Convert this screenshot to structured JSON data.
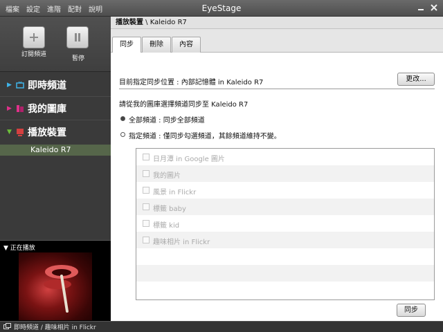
{
  "app": {
    "title": "EyeStage",
    "menu": [
      "檔案",
      "設定",
      "進階",
      "配對",
      "說明"
    ]
  },
  "sidebar": {
    "subscribe_label": "訂閱頻道",
    "pause_label": "暫停",
    "items": [
      {
        "label": "即時頻道",
        "color": "#3fb3e8"
      },
      {
        "label": "我的圖庫",
        "color": "#e0308a"
      },
      {
        "label": "播放裝置",
        "color": "#d44040"
      }
    ],
    "device": "Kaleido R7",
    "now_playing_label": "正在播放"
  },
  "status_bar": {
    "text": "即時頻道 / 趣味相片 in Flickr"
  },
  "main": {
    "breadcrumb_bold": "播放裝置",
    "breadcrumb_rest": " \\ Kaleido R7",
    "tabs": [
      {
        "label": "同步",
        "active": true
      },
      {
        "label": "刪除",
        "active": false
      },
      {
        "label": "內容",
        "active": false
      }
    ],
    "sync_location_text": "目前指定同步位置 : 內部記憶體 in Kaleido R7",
    "change_button": "更改...",
    "instruction": "請從我的圖庫選擇頻道同步至 Kaleido R7",
    "option_all": "全部頻道 : 同步全部頻道",
    "option_selected": "指定頻道 : 僅同步勾選頻道，其餘頻道維持不變。",
    "selected_option": "all",
    "channels": [
      "日月潭 in Google 圖片",
      "我的圖片",
      "風景 in Flickr",
      "標籤 baby",
      "標籤 kid",
      "趣味相片 in Flickr"
    ],
    "sync_button": "同步"
  }
}
